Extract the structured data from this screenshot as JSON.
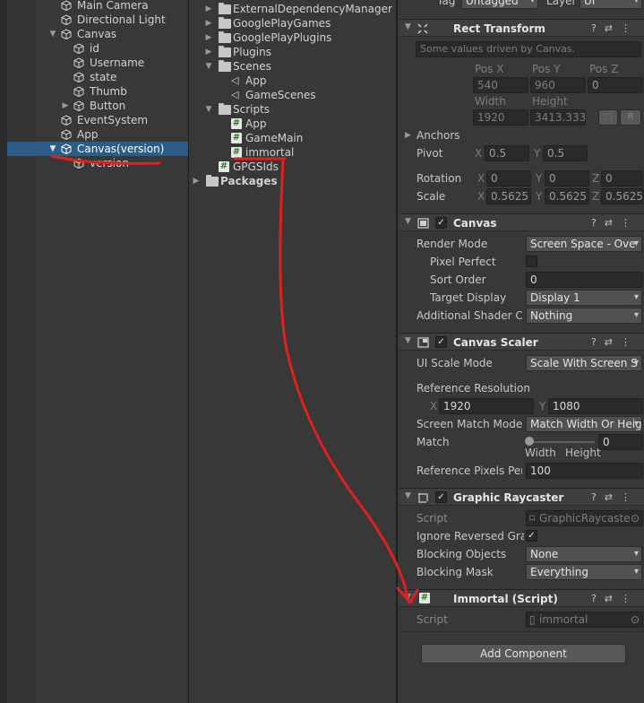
{
  "hierarchy": {
    "items": [
      {
        "label": "Main Camera"
      },
      {
        "label": "Directional Light"
      },
      {
        "label": "Canvas"
      },
      {
        "label": "id"
      },
      {
        "label": "Username"
      },
      {
        "label": "state"
      },
      {
        "label": "Thumb"
      },
      {
        "label": "Button"
      },
      {
        "label": "EventSystem"
      },
      {
        "label": "App"
      },
      {
        "label": "Canvas(version)"
      },
      {
        "label": "version"
      }
    ]
  },
  "project": {
    "items": [
      {
        "label": "ExternalDependencyManager"
      },
      {
        "label": "GooglePlayGames"
      },
      {
        "label": "GooglePlayPlugins"
      },
      {
        "label": "Plugins"
      },
      {
        "label": "Scenes"
      },
      {
        "label": "App"
      },
      {
        "label": "GameScenes"
      },
      {
        "label": "Scripts"
      },
      {
        "label": "App"
      },
      {
        "label": "GameMain"
      },
      {
        "label": "immortal"
      },
      {
        "label": "GPGSIds"
      },
      {
        "label": "Packages"
      }
    ]
  },
  "inspector": {
    "top": {
      "tag_label": "Tag",
      "tag_value": "Untagged",
      "layer_label": "Layer",
      "layer_value": "UI"
    },
    "rect_transform": {
      "title": "Rect Transform",
      "note": "Some values driven by Canvas.",
      "pos_x_label": "Pos X",
      "pos_y_label": "Pos Y",
      "pos_z_label": "Pos Z",
      "pos_x": "540",
      "pos_y": "960",
      "pos_z": "0",
      "width_label": "Width",
      "height_label": "Height",
      "width": "1920",
      "height": "3413.333",
      "r_label": "R",
      "anchors_label": "Anchors",
      "pivot_label": "Pivot",
      "pivot_x": "0.5",
      "pivot_y": "0.5",
      "rotation_label": "Rotation",
      "rot_x": "0",
      "rot_y": "0",
      "rot_z": "0",
      "scale_label": "Scale",
      "scale_x": "0.5625",
      "scale_y": "0.5625",
      "scale_z": "0.5625",
      "x": "X",
      "y": "Y",
      "z": "Z"
    },
    "canvas": {
      "title": "Canvas",
      "render_mode_label": "Render Mode",
      "render_mode": "Screen Space - Ove",
      "pixel_perfect_label": "Pixel Perfect",
      "sort_order_label": "Sort Order",
      "sort_order": "0",
      "target_display_label": "Target Display",
      "target_display": "Display 1",
      "shader_label": "Additional Shader Ch",
      "shader_value": "Nothing"
    },
    "canvas_scaler": {
      "title": "Canvas Scaler",
      "ui_scale_label": "UI Scale Mode",
      "ui_scale_value": "Scale With Screen S",
      "ref_res_label": "Reference Resolution",
      "ref_x": "1920",
      "ref_y": "1080",
      "match_mode_label": "Screen Match Mode",
      "match_mode_value": "Match Width Or Heig",
      "match_label": "Match",
      "match_value": "0",
      "match_fraction": 0,
      "width_sub": "Width",
      "height_sub": "Height",
      "ref_pixels_label": "Reference Pixels Per",
      "ref_pixels_value": "100"
    },
    "graphic_raycaster": {
      "title": "Graphic Raycaster",
      "script_label": "Script",
      "script_value": "GraphicRaycaste",
      "ignore_label": "Ignore Reversed Grap",
      "blocking_objects_label": "Blocking Objects",
      "blocking_objects_value": "None",
      "blocking_mask_label": "Blocking Mask",
      "blocking_mask_value": "Everything"
    },
    "immortal": {
      "title": "Immortal (Script)",
      "script_label": "Script",
      "script_value": "immortal"
    },
    "add_component_label": "Add Component",
    "check_mark": "✓"
  },
  "colors": {
    "annotation": "#e0201c",
    "selection": "#2c5d87"
  }
}
